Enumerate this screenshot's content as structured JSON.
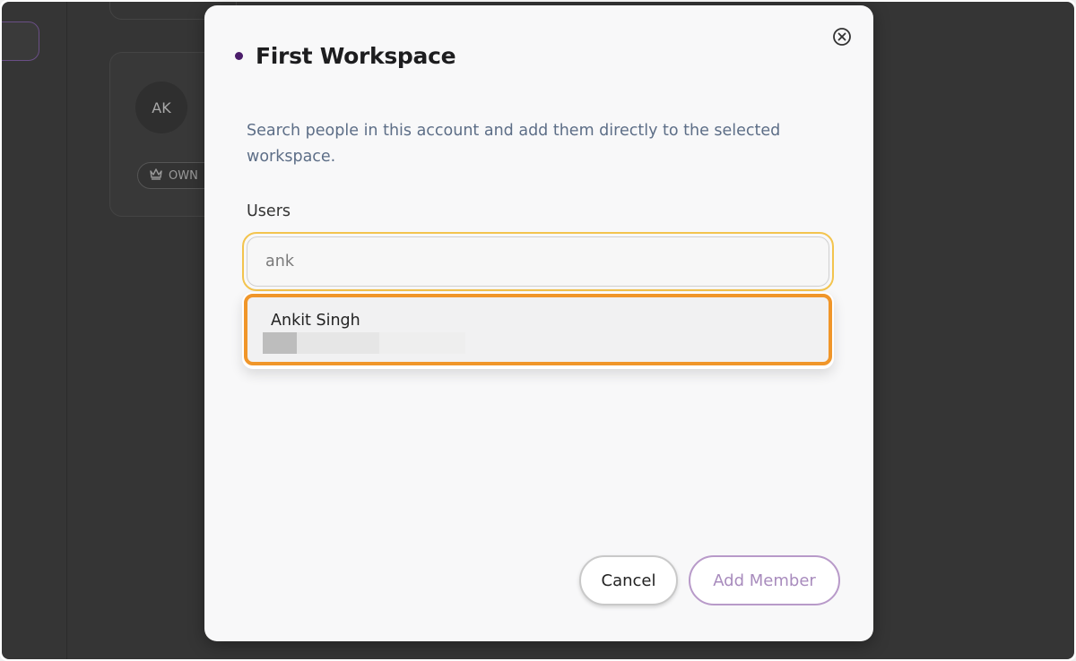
{
  "background": {
    "avatar_initials": "AK",
    "badge_label": "OWN"
  },
  "modal": {
    "title": "First Workspace",
    "description": "Search people in this account and add them directly to the selected workspace.",
    "users_label": "Users",
    "search": {
      "value": "ank",
      "placeholder": ""
    },
    "results": [
      {
        "name": "Ankit Singh"
      }
    ],
    "cancel_label": "Cancel",
    "add_member_label": "Add Member"
  },
  "colors": {
    "accent_purple": "#4b1d6b",
    "focus_yellow": "#f3c44e",
    "highlight_orange": "#f0962a",
    "add_button_text": "#a88bbd"
  },
  "icons": {
    "close": "close-circle-icon",
    "crown": "crown-icon"
  }
}
